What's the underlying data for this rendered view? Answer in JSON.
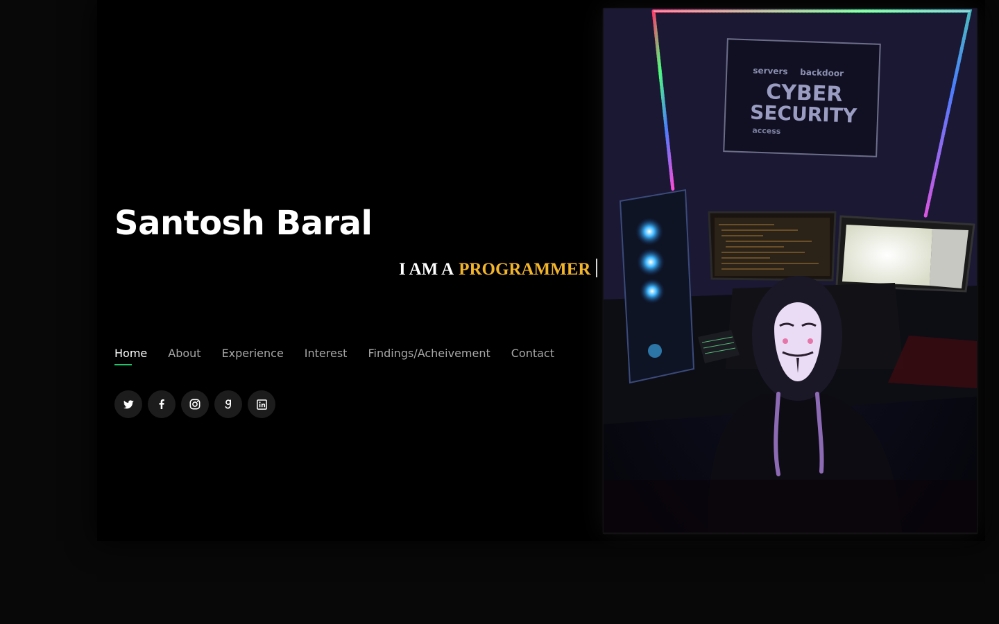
{
  "hero": {
    "name": "Santosh Baral",
    "tagline_prefix": "I AM A",
    "tagline_role": "PROGRAMMER"
  },
  "nav": {
    "items": [
      {
        "label": "Home",
        "active": true
      },
      {
        "label": "About",
        "active": false
      },
      {
        "label": "Experience",
        "active": false
      },
      {
        "label": "Interest",
        "active": false
      },
      {
        "label": "Findings/Acheivement",
        "active": false
      },
      {
        "label": "Contact",
        "active": false
      }
    ]
  },
  "socials": [
    {
      "icon": "twitter-icon"
    },
    {
      "icon": "facebook-icon"
    },
    {
      "icon": "instagram-icon"
    },
    {
      "icon": "goodreads-icon"
    },
    {
      "icon": "linkedin-icon"
    }
  ],
  "photo": {
    "poster_line_1": "CYBER",
    "poster_line_2": "SECURITY",
    "poster_word_servers": "servers",
    "poster_word_backdoor": "backdoor",
    "poster_word_access": "access"
  },
  "colors": {
    "accent": "#f2b42a",
    "nav_underline": "#23c36b",
    "background": "#000000"
  }
}
